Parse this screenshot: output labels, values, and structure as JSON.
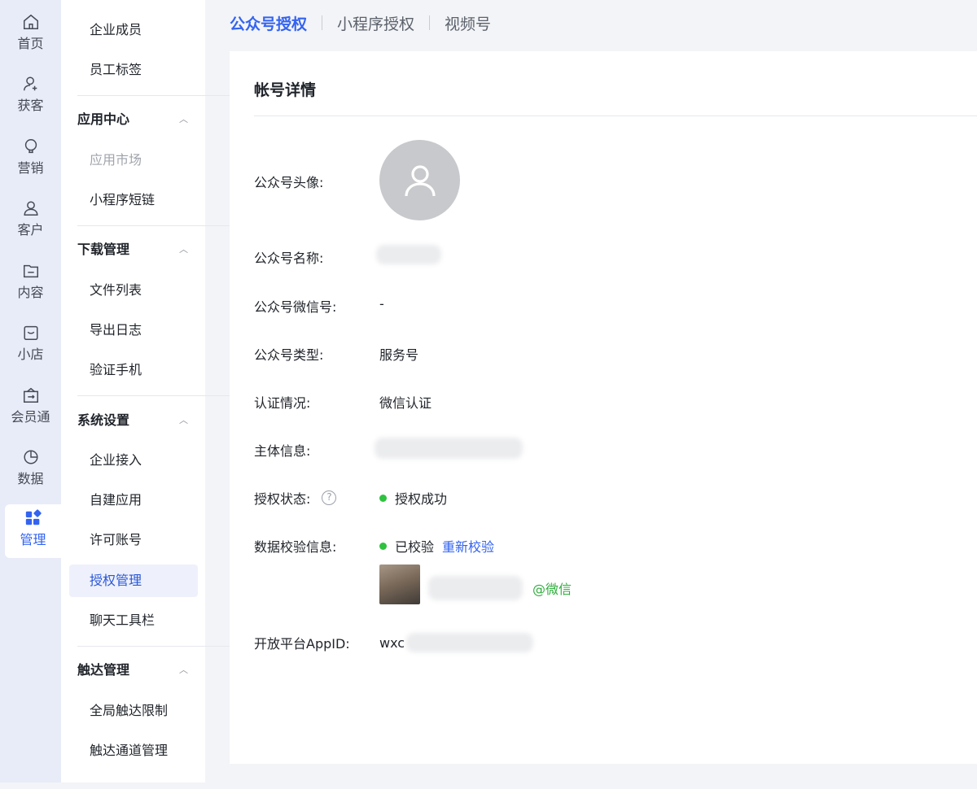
{
  "rail": {
    "items": [
      {
        "label": "首页",
        "icon": "home-icon"
      },
      {
        "label": "获客",
        "icon": "add-user-icon"
      },
      {
        "label": "营销",
        "icon": "bulb-icon"
      },
      {
        "label": "客户",
        "icon": "user-icon"
      },
      {
        "label": "内容",
        "icon": "folder-icon"
      },
      {
        "label": "小店",
        "icon": "shop-icon"
      },
      {
        "label": "会员通",
        "icon": "member-icon"
      },
      {
        "label": "数据",
        "icon": "pie-chart-icon"
      },
      {
        "label": "管理",
        "icon": "grid-manage-icon",
        "active": true
      }
    ]
  },
  "subnav": {
    "top_items": [
      "企业成员",
      "员工标签"
    ],
    "groups": [
      {
        "title": "应用中心",
        "items": [
          "应用市场",
          "小程序短链"
        ]
      },
      {
        "title": "下载管理",
        "items": [
          "文件列表",
          "导出日志",
          "验证手机"
        ]
      },
      {
        "title": "系统设置",
        "items": [
          "企业接入",
          "自建应用",
          "许可账号",
          "授权管理",
          "聊天工具栏"
        ]
      },
      {
        "title": "触达管理",
        "items": [
          "全局触达限制",
          "触达通道管理"
        ]
      }
    ],
    "active_item": "授权管理",
    "disabled_item": "应用市场"
  },
  "tabs": [
    {
      "label": "公众号授权",
      "active": true
    },
    {
      "label": "小程序授权"
    },
    {
      "label": "视频号"
    }
  ],
  "detail": {
    "title": "帐号详情",
    "fields": {
      "avatar_label": "公众号头像:",
      "name_label": "公众号名称:",
      "wechat_id_label": "公众号微信号:",
      "wechat_id_value": "-",
      "type_label": "公众号类型:",
      "type_value": "服务号",
      "cert_label": "认证情况:",
      "cert_value": "微信认证",
      "subject_label": "主体信息:",
      "auth_label": "授权状态:",
      "auth_value": "授权成功",
      "verify_label": "数据校验信息:",
      "verify_value": "已校验",
      "reverify_link": "重新校验",
      "verify_tag": "@微信",
      "appid_label": "开放平台AppID:",
      "appid_prefix": "wxc"
    },
    "status_color": "#2ec23e",
    "accent_color": "#3363f1"
  }
}
